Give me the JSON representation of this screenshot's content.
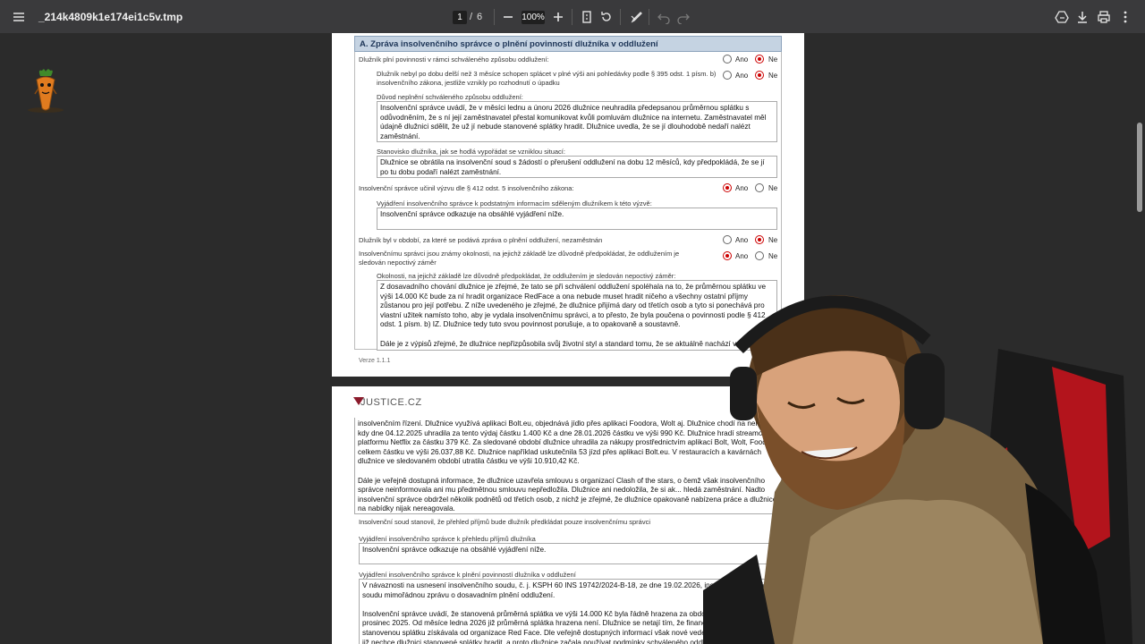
{
  "toolbar": {
    "filename": "_214k4809k1e174ei1c5v.tmp",
    "page_current": "1",
    "page_separator": "/",
    "page_total": "6",
    "zoom": "100%",
    "icons": [
      "menu-icon",
      "zoom-out-icon",
      "zoom-in-icon",
      "fit-page-icon",
      "rotate-icon",
      "draw-icon",
      "undo-icon",
      "redo-icon",
      "drive-icon",
      "download-icon",
      "print-icon",
      "more-icon"
    ]
  },
  "page1": {
    "section_title": "A. Zpráva insolvenčního správce o plnění povinností dlužníka v oddlužení",
    "q1": "Dlužník plní povinnosti v rámci schváleného způsobu oddlužení:",
    "q2": "Dlužník nebyl po dobu delší než 3 měsíce schopen splácet v plné výši ani pohledávky podle § 395 odst. 1 písm. b) insolvenčního zákona, jestliže vznikly po rozhodnutí o úpadku",
    "reason_label": "Důvod neplnění schváleného způsobu oddlužení:",
    "reason_text": "Insolvenční správce uvádí, že v měsíci lednu a únoru 2026 dlužnice neuhradila předepsanou průměrnou splátku s odůvodněním, že s ní její zaměstnavatel přestal komunikovat kvůli pomluvám dlužnice na internetu. Zaměstnavatel měl údajně dlužnici sdělit, že už jí nebude stanovené splátky hradit. Dlužnice uvedla, že se jí dlouhodobě nedaří nalézt zaměstnání.",
    "debtor_label": "Stanovisko dlužníka, jak se hodlá vypořádat se vzniklou situací:",
    "debtor_text": "Dlužnice se obrátila na insolvenční soud s žádostí o přerušení oddlužení na dobu 12 měsíců, kdy předpokládá, že se jí po tu dobu podaří nalézt zaměstnání.",
    "q3": "Insolvenční správce učinil výzvu dle § 412 odst. 5 insolvenčního zákona:",
    "q3_label": "Vyjádření insolvenčního správce k podstatným informacím sděleným dlužníkem k této výzvě:",
    "q3_text": "Insolvenční správce odkazuje na obsáhlé vyjádření níže.",
    "q4": "Dlužník byl v období, za které se podává zpráva o plnění oddlužení, nezaměstnán",
    "q5": "Insolvenčnímu správci jsou známy okolnosti, na jejichž základě lze důvodně předpokládat, že oddlužením je sledován nepoctivý záměr",
    "q5_label": "Okolnosti, na jejichž základě lze důvodně předpokládat, že oddlužením je sledován nepoctivý záměr:",
    "q5_text": "Z dosavadního chování dlužnice je zřejmé, že tato se při schválení oddlužení spoléhala na to, že průměrnou splátku ve výši 14.000 Kč bude za ní hradit organizace RedFace a ona nebude muset hradit ničeho a všechny ostatní příjmy zůstanou pro její potřebu. Z níže uvedeného je zřejmé, že dlužnice přijímá dary od třetích osob a tyto si ponechává pro vlastní užitek namísto toho, aby je vydala insolvenčnímu správci, a to přesto, že byla poučena o povinnosti podle § 412 odst. 1 písm. b) IZ. Dlužnice tedy tuto svou povinnost porušuje, a to opakovaně a soustavně.\n\nDále je z výpisů zřejmé, že dlužnice nepřizpůsobila svůj životní styl a standard tomu, že se aktuálně nachází v",
    "ano": "Ano",
    "ne": "Ne",
    "version": "Verze  1.1.1"
  },
  "page2": {
    "logo_text": "JUSTICE.CZ",
    "cont_text": "insolvenčním řízení. Dlužnice využívá aplikaci Bolt.eu, objednává jídlo přes aplikaci Foodora, Wolt aj. Dlužnice chodí na nehty, kdy dne 04.12.2025 uhradila za tento výdaj částku 1.400 Kč a dne 28.01.2026 částku ve výši 990 Kč. Dlužnice hradí streamovací platformu Netflix za částku 379 Kč. Za sledované období dlužnice uhradila za nákupy prostřednictvím aplikací Bolt, Wolt, Foodora celkem částku ve výši 26.037,88 Kč. Dlužnice například uskutečnila 53 jízd přes aplikaci Bolt.eu. V restauracích a kavárnách dlužnice ve sledovaném období utratila částku ve výši 10.910,42 Kč.\n\nDále je veřejně dostupná informace, že dlužnice uzavřela smlouvu s organizací Clash of the stars, o čemž však insolvenčního správce neinformovala ani mu předmětnou smlouvu nepředložila. Dlužnice ani nedoložila, že si ak... hledá zaměstnání. Nadto insolvenční správce obdržel několik podnětů od třetích osob, z nichž je zřejmé, že dlužnice opakovaně nabízena práce a dlužnice na nabídky nijak nereagovala.",
    "q6": "Insolvenční soud stanovil, že přehled příjmů bude dlužník předkládat pouze insolvenčnímu správci",
    "q7_label": "Vyjádření insolvenčního správce k přehledu příjmů dlužníka",
    "q7_text": "Insolvenční správce odkazuje na obsáhlé vyjádření níže.",
    "q8_label": "Vyjádření insolvenčního správce k plnění povinností dlužníka v oddlužení",
    "q8_text": "V návaznosti na usnesení insolvenčního soudu, č. j. KSPH 60 INS 19742/2024-B-18, ze dne 19.02.2026, ins... tímto podává soudu mimořádnou zprávu o dosavadním plnění oddlužení.\n\nInsolvenční správce uvádí, že stanovená průměrná splátka ve výši 14.000 Kč byla řádně hrazena za období ... en 2025 - prosinec 2025. Od měsíce ledna 2026 již průměrná splátka hrazena není. Dlužnice se netají tím, že finanční prostředky na stanovenou splátku získávala od organizace Red Face. Dle veřejně dostupných informací však nové vedení organizace Face již nechce dlužnici stanovené splátky hradit, a proto dlužnice začala používat podmínky schváleného oddlužení"
  },
  "overlay": {
    "webcam_desc_icon": "person-icon"
  }
}
